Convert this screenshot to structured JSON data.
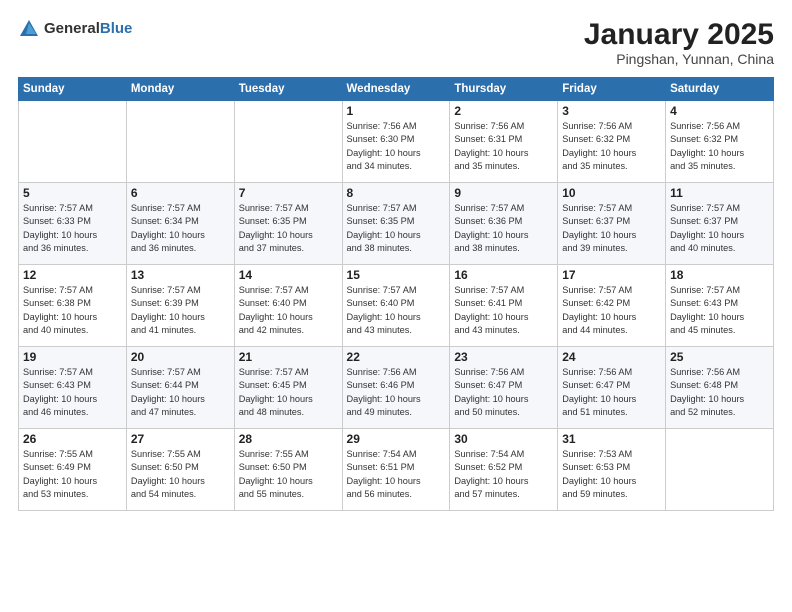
{
  "header": {
    "logo_general": "General",
    "logo_blue": "Blue",
    "month_title": "January 2025",
    "location": "Pingshan, Yunnan, China"
  },
  "days_of_week": [
    "Sunday",
    "Monday",
    "Tuesday",
    "Wednesday",
    "Thursday",
    "Friday",
    "Saturday"
  ],
  "weeks": [
    [
      {
        "day": "",
        "info": ""
      },
      {
        "day": "",
        "info": ""
      },
      {
        "day": "",
        "info": ""
      },
      {
        "day": "1",
        "info": "Sunrise: 7:56 AM\nSunset: 6:30 PM\nDaylight: 10 hours\nand 34 minutes."
      },
      {
        "day": "2",
        "info": "Sunrise: 7:56 AM\nSunset: 6:31 PM\nDaylight: 10 hours\nand 35 minutes."
      },
      {
        "day": "3",
        "info": "Sunrise: 7:56 AM\nSunset: 6:32 PM\nDaylight: 10 hours\nand 35 minutes."
      },
      {
        "day": "4",
        "info": "Sunrise: 7:56 AM\nSunset: 6:32 PM\nDaylight: 10 hours\nand 35 minutes."
      }
    ],
    [
      {
        "day": "5",
        "info": "Sunrise: 7:57 AM\nSunset: 6:33 PM\nDaylight: 10 hours\nand 36 minutes."
      },
      {
        "day": "6",
        "info": "Sunrise: 7:57 AM\nSunset: 6:34 PM\nDaylight: 10 hours\nand 36 minutes."
      },
      {
        "day": "7",
        "info": "Sunrise: 7:57 AM\nSunset: 6:35 PM\nDaylight: 10 hours\nand 37 minutes."
      },
      {
        "day": "8",
        "info": "Sunrise: 7:57 AM\nSunset: 6:35 PM\nDaylight: 10 hours\nand 38 minutes."
      },
      {
        "day": "9",
        "info": "Sunrise: 7:57 AM\nSunset: 6:36 PM\nDaylight: 10 hours\nand 38 minutes."
      },
      {
        "day": "10",
        "info": "Sunrise: 7:57 AM\nSunset: 6:37 PM\nDaylight: 10 hours\nand 39 minutes."
      },
      {
        "day": "11",
        "info": "Sunrise: 7:57 AM\nSunset: 6:37 PM\nDaylight: 10 hours\nand 40 minutes."
      }
    ],
    [
      {
        "day": "12",
        "info": "Sunrise: 7:57 AM\nSunset: 6:38 PM\nDaylight: 10 hours\nand 40 minutes."
      },
      {
        "day": "13",
        "info": "Sunrise: 7:57 AM\nSunset: 6:39 PM\nDaylight: 10 hours\nand 41 minutes."
      },
      {
        "day": "14",
        "info": "Sunrise: 7:57 AM\nSunset: 6:40 PM\nDaylight: 10 hours\nand 42 minutes."
      },
      {
        "day": "15",
        "info": "Sunrise: 7:57 AM\nSunset: 6:40 PM\nDaylight: 10 hours\nand 43 minutes."
      },
      {
        "day": "16",
        "info": "Sunrise: 7:57 AM\nSunset: 6:41 PM\nDaylight: 10 hours\nand 43 minutes."
      },
      {
        "day": "17",
        "info": "Sunrise: 7:57 AM\nSunset: 6:42 PM\nDaylight: 10 hours\nand 44 minutes."
      },
      {
        "day": "18",
        "info": "Sunrise: 7:57 AM\nSunset: 6:43 PM\nDaylight: 10 hours\nand 45 minutes."
      }
    ],
    [
      {
        "day": "19",
        "info": "Sunrise: 7:57 AM\nSunset: 6:43 PM\nDaylight: 10 hours\nand 46 minutes."
      },
      {
        "day": "20",
        "info": "Sunrise: 7:57 AM\nSunset: 6:44 PM\nDaylight: 10 hours\nand 47 minutes."
      },
      {
        "day": "21",
        "info": "Sunrise: 7:57 AM\nSunset: 6:45 PM\nDaylight: 10 hours\nand 48 minutes."
      },
      {
        "day": "22",
        "info": "Sunrise: 7:56 AM\nSunset: 6:46 PM\nDaylight: 10 hours\nand 49 minutes."
      },
      {
        "day": "23",
        "info": "Sunrise: 7:56 AM\nSunset: 6:47 PM\nDaylight: 10 hours\nand 50 minutes."
      },
      {
        "day": "24",
        "info": "Sunrise: 7:56 AM\nSunset: 6:47 PM\nDaylight: 10 hours\nand 51 minutes."
      },
      {
        "day": "25",
        "info": "Sunrise: 7:56 AM\nSunset: 6:48 PM\nDaylight: 10 hours\nand 52 minutes."
      }
    ],
    [
      {
        "day": "26",
        "info": "Sunrise: 7:55 AM\nSunset: 6:49 PM\nDaylight: 10 hours\nand 53 minutes."
      },
      {
        "day": "27",
        "info": "Sunrise: 7:55 AM\nSunset: 6:50 PM\nDaylight: 10 hours\nand 54 minutes."
      },
      {
        "day": "28",
        "info": "Sunrise: 7:55 AM\nSunset: 6:50 PM\nDaylight: 10 hours\nand 55 minutes."
      },
      {
        "day": "29",
        "info": "Sunrise: 7:54 AM\nSunset: 6:51 PM\nDaylight: 10 hours\nand 56 minutes."
      },
      {
        "day": "30",
        "info": "Sunrise: 7:54 AM\nSunset: 6:52 PM\nDaylight: 10 hours\nand 57 minutes."
      },
      {
        "day": "31",
        "info": "Sunrise: 7:53 AM\nSunset: 6:53 PM\nDaylight: 10 hours\nand 59 minutes."
      },
      {
        "day": "",
        "info": ""
      }
    ]
  ]
}
